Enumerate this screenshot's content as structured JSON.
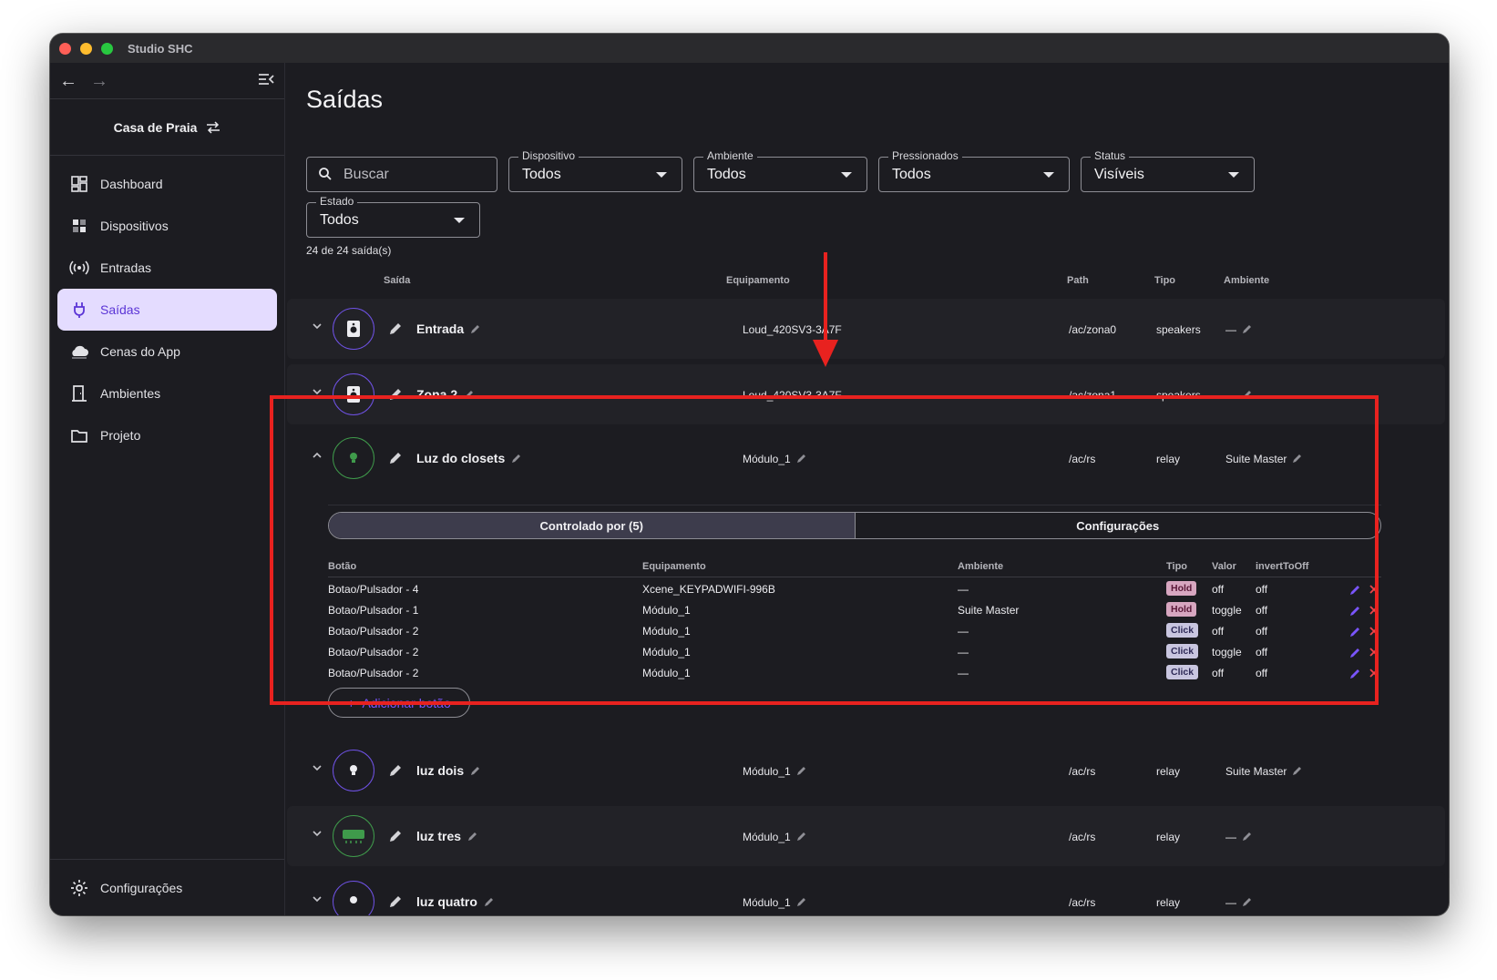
{
  "window": {
    "title": "Studio SHC"
  },
  "sidebar": {
    "house": "Casa de Praia",
    "items": [
      {
        "label": "Dashboard",
        "icon": "dashboard-icon"
      },
      {
        "label": "Dispositivos",
        "icon": "devices-icon"
      },
      {
        "label": "Entradas",
        "icon": "broadcast-icon"
      },
      {
        "label": "Saídas",
        "icon": "plug-icon",
        "active": true
      },
      {
        "label": "Cenas do App",
        "icon": "cloud-icon"
      },
      {
        "label": "Ambientes",
        "icon": "door-icon"
      },
      {
        "label": "Projeto",
        "icon": "folder-icon"
      }
    ],
    "settings": "Configurações"
  },
  "page": {
    "title": "Saídas",
    "search_placeholder": "Buscar",
    "filters": {
      "dispositivo": {
        "label": "Dispositivo",
        "value": "Todos"
      },
      "ambiente": {
        "label": "Ambiente",
        "value": "Todos"
      },
      "pressionados": {
        "label": "Pressionados",
        "value": "Todos"
      },
      "status": {
        "label": "Status",
        "value": "Visíveis"
      },
      "estado": {
        "label": "Estado",
        "value": "Todos"
      }
    },
    "count": "24 de 24 saída(s)"
  },
  "table": {
    "headers": {
      "saida": "Saída",
      "equipamento": "Equipamento",
      "path": "Path",
      "tipo": "Tipo",
      "ambiente": "Ambiente"
    },
    "rows": [
      {
        "name": "Entrada",
        "equipamento": "Loud_420SV3-3A7F",
        "path": "/ac/zona0",
        "tipo": "speakers",
        "ambiente": "—"
      },
      {
        "name": "Zona 2",
        "equipamento": "Loud_420SV3-3A7F",
        "path": "/ac/zona1",
        "tipo": "speakers",
        "ambiente": "—"
      },
      {
        "name": "Luz do closets",
        "equipamento": "Módulo_1",
        "path": "/ac/rs",
        "tipo": "relay",
        "ambiente": "Suite Master"
      },
      {
        "name": "luz dois",
        "equipamento": "Módulo_1",
        "path": "/ac/rs",
        "tipo": "relay",
        "ambiente": "Suite Master"
      },
      {
        "name": "luz tres",
        "equipamento": "Módulo_1",
        "path": "/ac/rs",
        "tipo": "relay",
        "ambiente": "—"
      },
      {
        "name": "luz quatro",
        "equipamento": "Módulo_1",
        "path": "/ac/rs",
        "tipo": "relay",
        "ambiente": "—"
      }
    ]
  },
  "expanded": {
    "tabs": {
      "controlled": "Controlado por (5)",
      "config": "Configurações"
    },
    "headers": {
      "botao": "Botão",
      "equipamento": "Equipamento",
      "ambiente": "Ambiente",
      "tipo": "Tipo",
      "valor": "Valor",
      "invert": "invertToOff"
    },
    "rows": [
      {
        "botao": "Botao/Pulsador - 4",
        "equipamento": "Xcene_KEYPADWIFI-996B",
        "ambiente": "—",
        "tipo": "Hold",
        "valor": "off",
        "invert": "off"
      },
      {
        "botao": "Botao/Pulsador - 1",
        "equipamento": "Módulo_1",
        "ambiente": "Suite Master",
        "tipo": "Hold",
        "valor": "toggle",
        "invert": "off"
      },
      {
        "botao": "Botao/Pulsador - 2",
        "equipamento": "Módulo_1",
        "ambiente": "—",
        "tipo": "Click",
        "valor": "off",
        "invert": "off"
      },
      {
        "botao": "Botao/Pulsador - 2",
        "equipamento": "Módulo_1",
        "ambiente": "—",
        "tipo": "Click",
        "valor": "toggle",
        "invert": "off"
      },
      {
        "botao": "Botao/Pulsador - 2",
        "equipamento": "Módulo_1",
        "ambiente": "—",
        "tipo": "Click",
        "valor": "off",
        "invert": "off"
      }
    ],
    "add_button": "Adicionar botão"
  },
  "colors": {
    "accent": "#6f52e5",
    "active_bg": "#e4dcff",
    "highlight": "#e8221f",
    "green": "#3f9a4b"
  }
}
